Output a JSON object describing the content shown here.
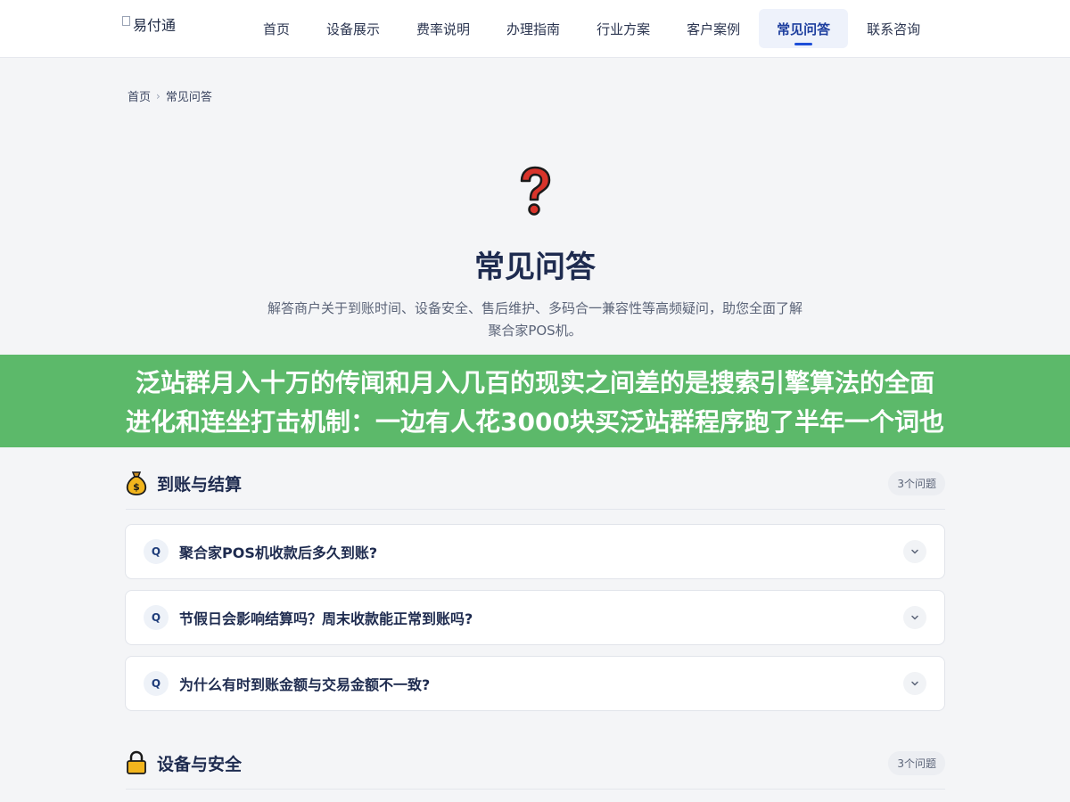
{
  "header": {
    "logo_alt": "易付通",
    "nav": [
      {
        "label": "首页"
      },
      {
        "label": "设备展示"
      },
      {
        "label": "费率说明"
      },
      {
        "label": "办理指南"
      },
      {
        "label": "行业方案"
      },
      {
        "label": "客户案例"
      },
      {
        "label": "常见问答",
        "active": true
      },
      {
        "label": "联系咨询"
      }
    ]
  },
  "breadcrumb": {
    "home": "首页",
    "separator": "›",
    "current": "常见问答"
  },
  "hero": {
    "icon": "question-mark-icon",
    "title": "常见问答",
    "description": "解答商户关于到账时间、设备安全、售后维护、多码合一兼容性等高频疑问，助您全面了解聚合家POS机。"
  },
  "banner": {
    "line1": "泛站群月入十万的传闻和月入几百的现实之间差的是搜索引擎算法的全面",
    "line2": "进化和连坐打击机制：一边有人花3000块买泛站群程序跑了半年一个词也"
  },
  "sections": [
    {
      "icon": "money-bag-icon",
      "title": "到账与结算",
      "count": "3个问题",
      "questions": [
        {
          "badge": "Q",
          "text": "聚合家POS机收款后多久到账?"
        },
        {
          "badge": "Q",
          "text": "节假日会影响结算吗？周末收款能正常到账吗?"
        },
        {
          "badge": "Q",
          "text": "为什么有时到账金额与交易金额不一致?"
        }
      ]
    },
    {
      "icon": "lock-icon",
      "title": "设备与安全",
      "count": "3个问题",
      "questions": []
    }
  ],
  "colors": {
    "accent": "#1d4ed8",
    "nav_active_bg": "#eef2fb",
    "banner_bg": "#5cb96a",
    "page_bg": "#f4f5f7"
  }
}
